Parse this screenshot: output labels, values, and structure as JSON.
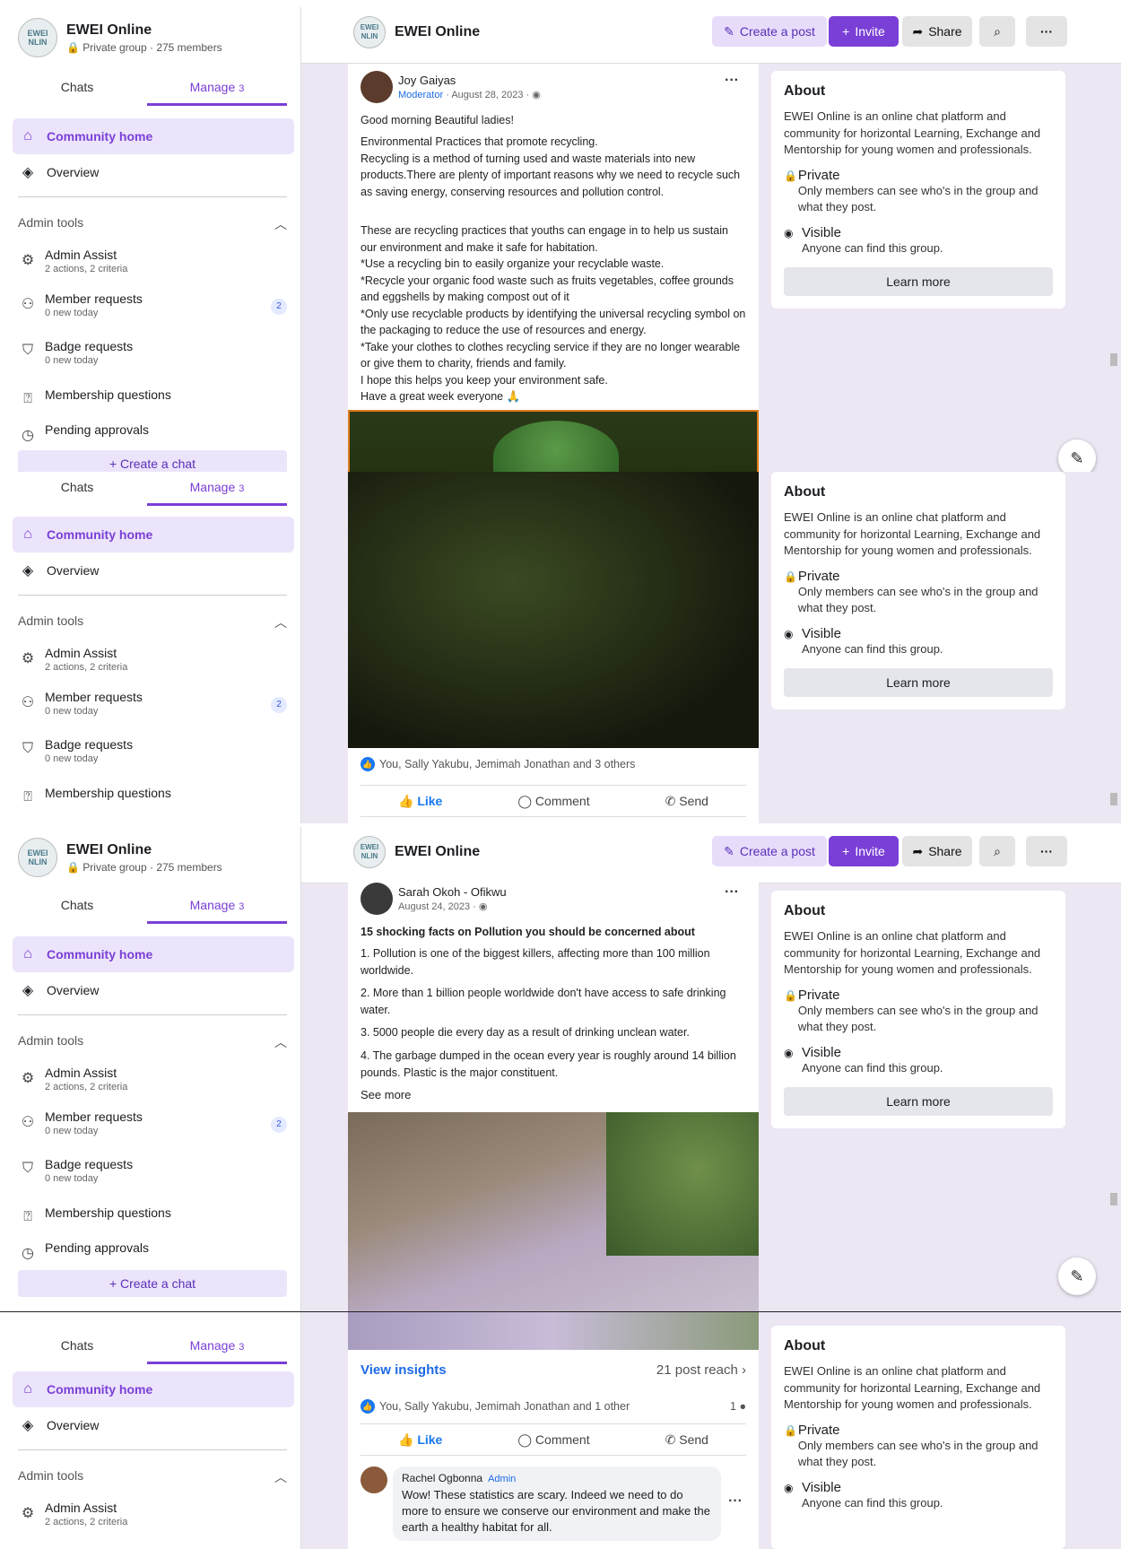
{
  "group": {
    "logo_text": "EWEI\nNLIN",
    "name": "EWEI Online",
    "meta": "Private group · 275 members"
  },
  "tabs": {
    "chats": "Chats",
    "manage": "Manage",
    "manage_count": "3"
  },
  "nav": {
    "community_home": "Community home",
    "overview": "Overview"
  },
  "admin_tools": {
    "title": "Admin tools",
    "items": [
      {
        "title": "Admin Assist",
        "sub": "2 actions, 2 criteria"
      },
      {
        "title": "Member requests",
        "sub": "0 new today",
        "badge": "2"
      },
      {
        "title": "Badge requests",
        "sub": "0 new today"
      },
      {
        "title": "Membership questions",
        "sub": ""
      },
      {
        "title": "Pending approvals",
        "sub": ""
      }
    ]
  },
  "create_chat": "+ Create a chat",
  "topbar": {
    "create_post": "Create a post",
    "invite": "Invite",
    "share": "Share",
    "more": "···"
  },
  "post1": {
    "author": "Joy Gaiyas",
    "role": "Moderator",
    "date": "· August 28, 2023 · ◉",
    "greeting": "Good morning Beautiful ladies!",
    "p1": "Environmental Practices that promote recycling.\nRecycling is a method of turning used and waste materials into new products.There are plenty of important reasons why we need to recycle such as saving energy, conserving resources and pollution control.",
    "p2": "These are recycling practices that youths can engage in to help us sustain our environment and make it safe for habitation.\n*Use a recycling bin to easily organize your recyclable waste.\n*Recycle your organic food waste such as fruits vegetables, coffee grounds and eggshells by making compost out of it\n*Only use recyclable products by identifying the universal recycling symbol on the packaging to reduce the use of resources and energy.\n*Take your clothes to clothes recycling service if they are no longer wearable or give them to charity, friends and family.\n I hope this helps you keep your environment safe.\nHave a great week everyone 🙏",
    "reactions": "You, Sally Yakubu, Jemimah Jonathan and 3 others"
  },
  "actions": {
    "like": "Like",
    "comment": "Comment",
    "send": "Send"
  },
  "post2": {
    "author": "Sarah Okoh - Ofikwu",
    "date": "August 24, 2023 · ◉",
    "headline": "15 shocking facts on Pollution you should be concerned about",
    "f1": "1. Pollution is one of the biggest killers, affecting more than 100 million worldwide.",
    "f2": "2. More than 1 billion people worldwide don't have access to safe drinking water.",
    "f3": "3. 5000 people die every day as a result of drinking unclean water.",
    "f4": "4. The garbage dumped in the ocean every year is roughly around 14 billion pounds. Plastic is the major constituent.",
    "see_more": "See more",
    "view_insights": "View insights",
    "post_reach": "21 post reach",
    "reactions": "You, Sally Yakubu, Jemimah Jonathan and 1 other",
    "comment_count": "1"
  },
  "comment": {
    "author": "Rachel Ogbonna",
    "role": "Admin",
    "text": "Wow! These statistics are scary. Indeed we need to do more to ensure we conserve our environment and make the earth a healthy habitat for all."
  },
  "about": {
    "title": "About",
    "desc": "EWEI Online is an online chat platform and community for horizontal Learning, Exchange and Mentorship for young women and professionals.",
    "private_title": "Private",
    "private_desc": "Only members can see who's in the group and what they post.",
    "visible_title": "Visible",
    "visible_desc": "Anyone can find this group.",
    "learn_more": "Learn more"
  },
  "colors": {
    "accent": "#7a3fd6",
    "link": "#1d6ae5",
    "bg": "#ece7f3"
  }
}
